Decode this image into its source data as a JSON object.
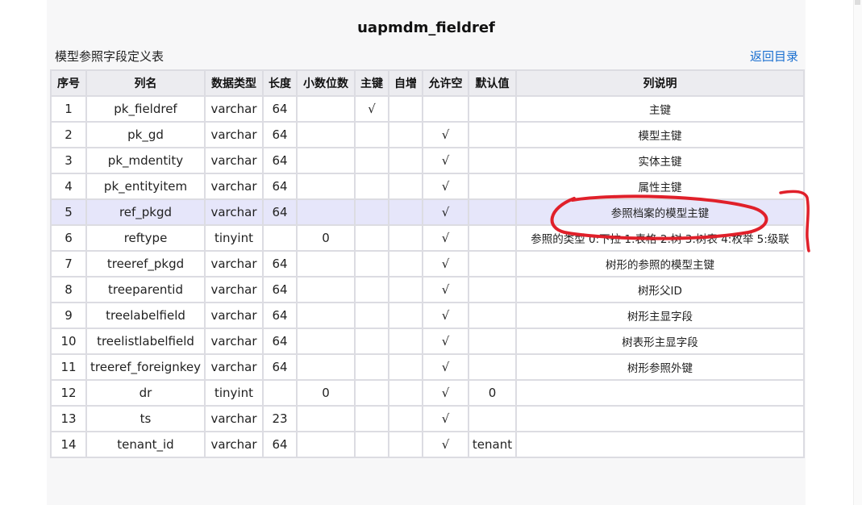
{
  "page": {
    "title": "uapmdm_fieldref",
    "subtitle": "模型参照字段定义表",
    "back_link": "返回目录"
  },
  "table": {
    "headers": [
      "序号",
      "列名",
      "数据类型",
      "长度",
      "小数位数",
      "主键",
      "自增",
      "允许空",
      "默认值",
      "列说明"
    ],
    "rows": [
      [
        "1",
        "pk_fieldref",
        "varchar",
        "64",
        "",
        "√",
        "",
        "",
        "",
        "主键"
      ],
      [
        "2",
        "pk_gd",
        "varchar",
        "64",
        "",
        "",
        "",
        "√",
        "",
        "模型主键"
      ],
      [
        "3",
        "pk_mdentity",
        "varchar",
        "64",
        "",
        "",
        "",
        "√",
        "",
        "实体主键"
      ],
      [
        "4",
        "pk_entityitem",
        "varchar",
        "64",
        "",
        "",
        "",
        "√",
        "",
        "属性主键"
      ],
      [
        "5",
        "ref_pkgd",
        "varchar",
        "64",
        "",
        "",
        "",
        "√",
        "",
        "参照档案的模型主键"
      ],
      [
        "6",
        "reftype",
        "tinyint",
        "",
        "0",
        "",
        "",
        "√",
        "",
        "参照的类型 0:下拉 1:表格 2:树 3:树表 4:枚举 5:级联"
      ],
      [
        "7",
        "treeref_pkgd",
        "varchar",
        "64",
        "",
        "",
        "",
        "√",
        "",
        "树形的参照的模型主键"
      ],
      [
        "8",
        "treeparentid",
        "varchar",
        "64",
        "",
        "",
        "",
        "√",
        "",
        "树形父ID"
      ],
      [
        "9",
        "treelabelfield",
        "varchar",
        "64",
        "",
        "",
        "",
        "√",
        "",
        "树形主显字段"
      ],
      [
        "10",
        "treelistlabelfield",
        "varchar",
        "64",
        "",
        "",
        "",
        "√",
        "",
        "树表形主显字段"
      ],
      [
        "11",
        "treeref_foreignkey",
        "varchar",
        "64",
        "",
        "",
        "",
        "√",
        "",
        "树形参照外键"
      ],
      [
        "12",
        "dr",
        "tinyint",
        "",
        "0",
        "",
        "",
        "√",
        "0",
        ""
      ],
      [
        "13",
        "ts",
        "varchar",
        "23",
        "",
        "",
        "",
        "√",
        "",
        ""
      ],
      [
        "14",
        "tenant_id",
        "varchar",
        "64",
        "",
        "",
        "",
        "√",
        "tenant",
        ""
      ]
    ]
  },
  "highlighted_row_index": 4,
  "colors": {
    "link": "#1a6fd0",
    "highlight_row": "#e6e6fa",
    "annotation": "#e0202a"
  }
}
